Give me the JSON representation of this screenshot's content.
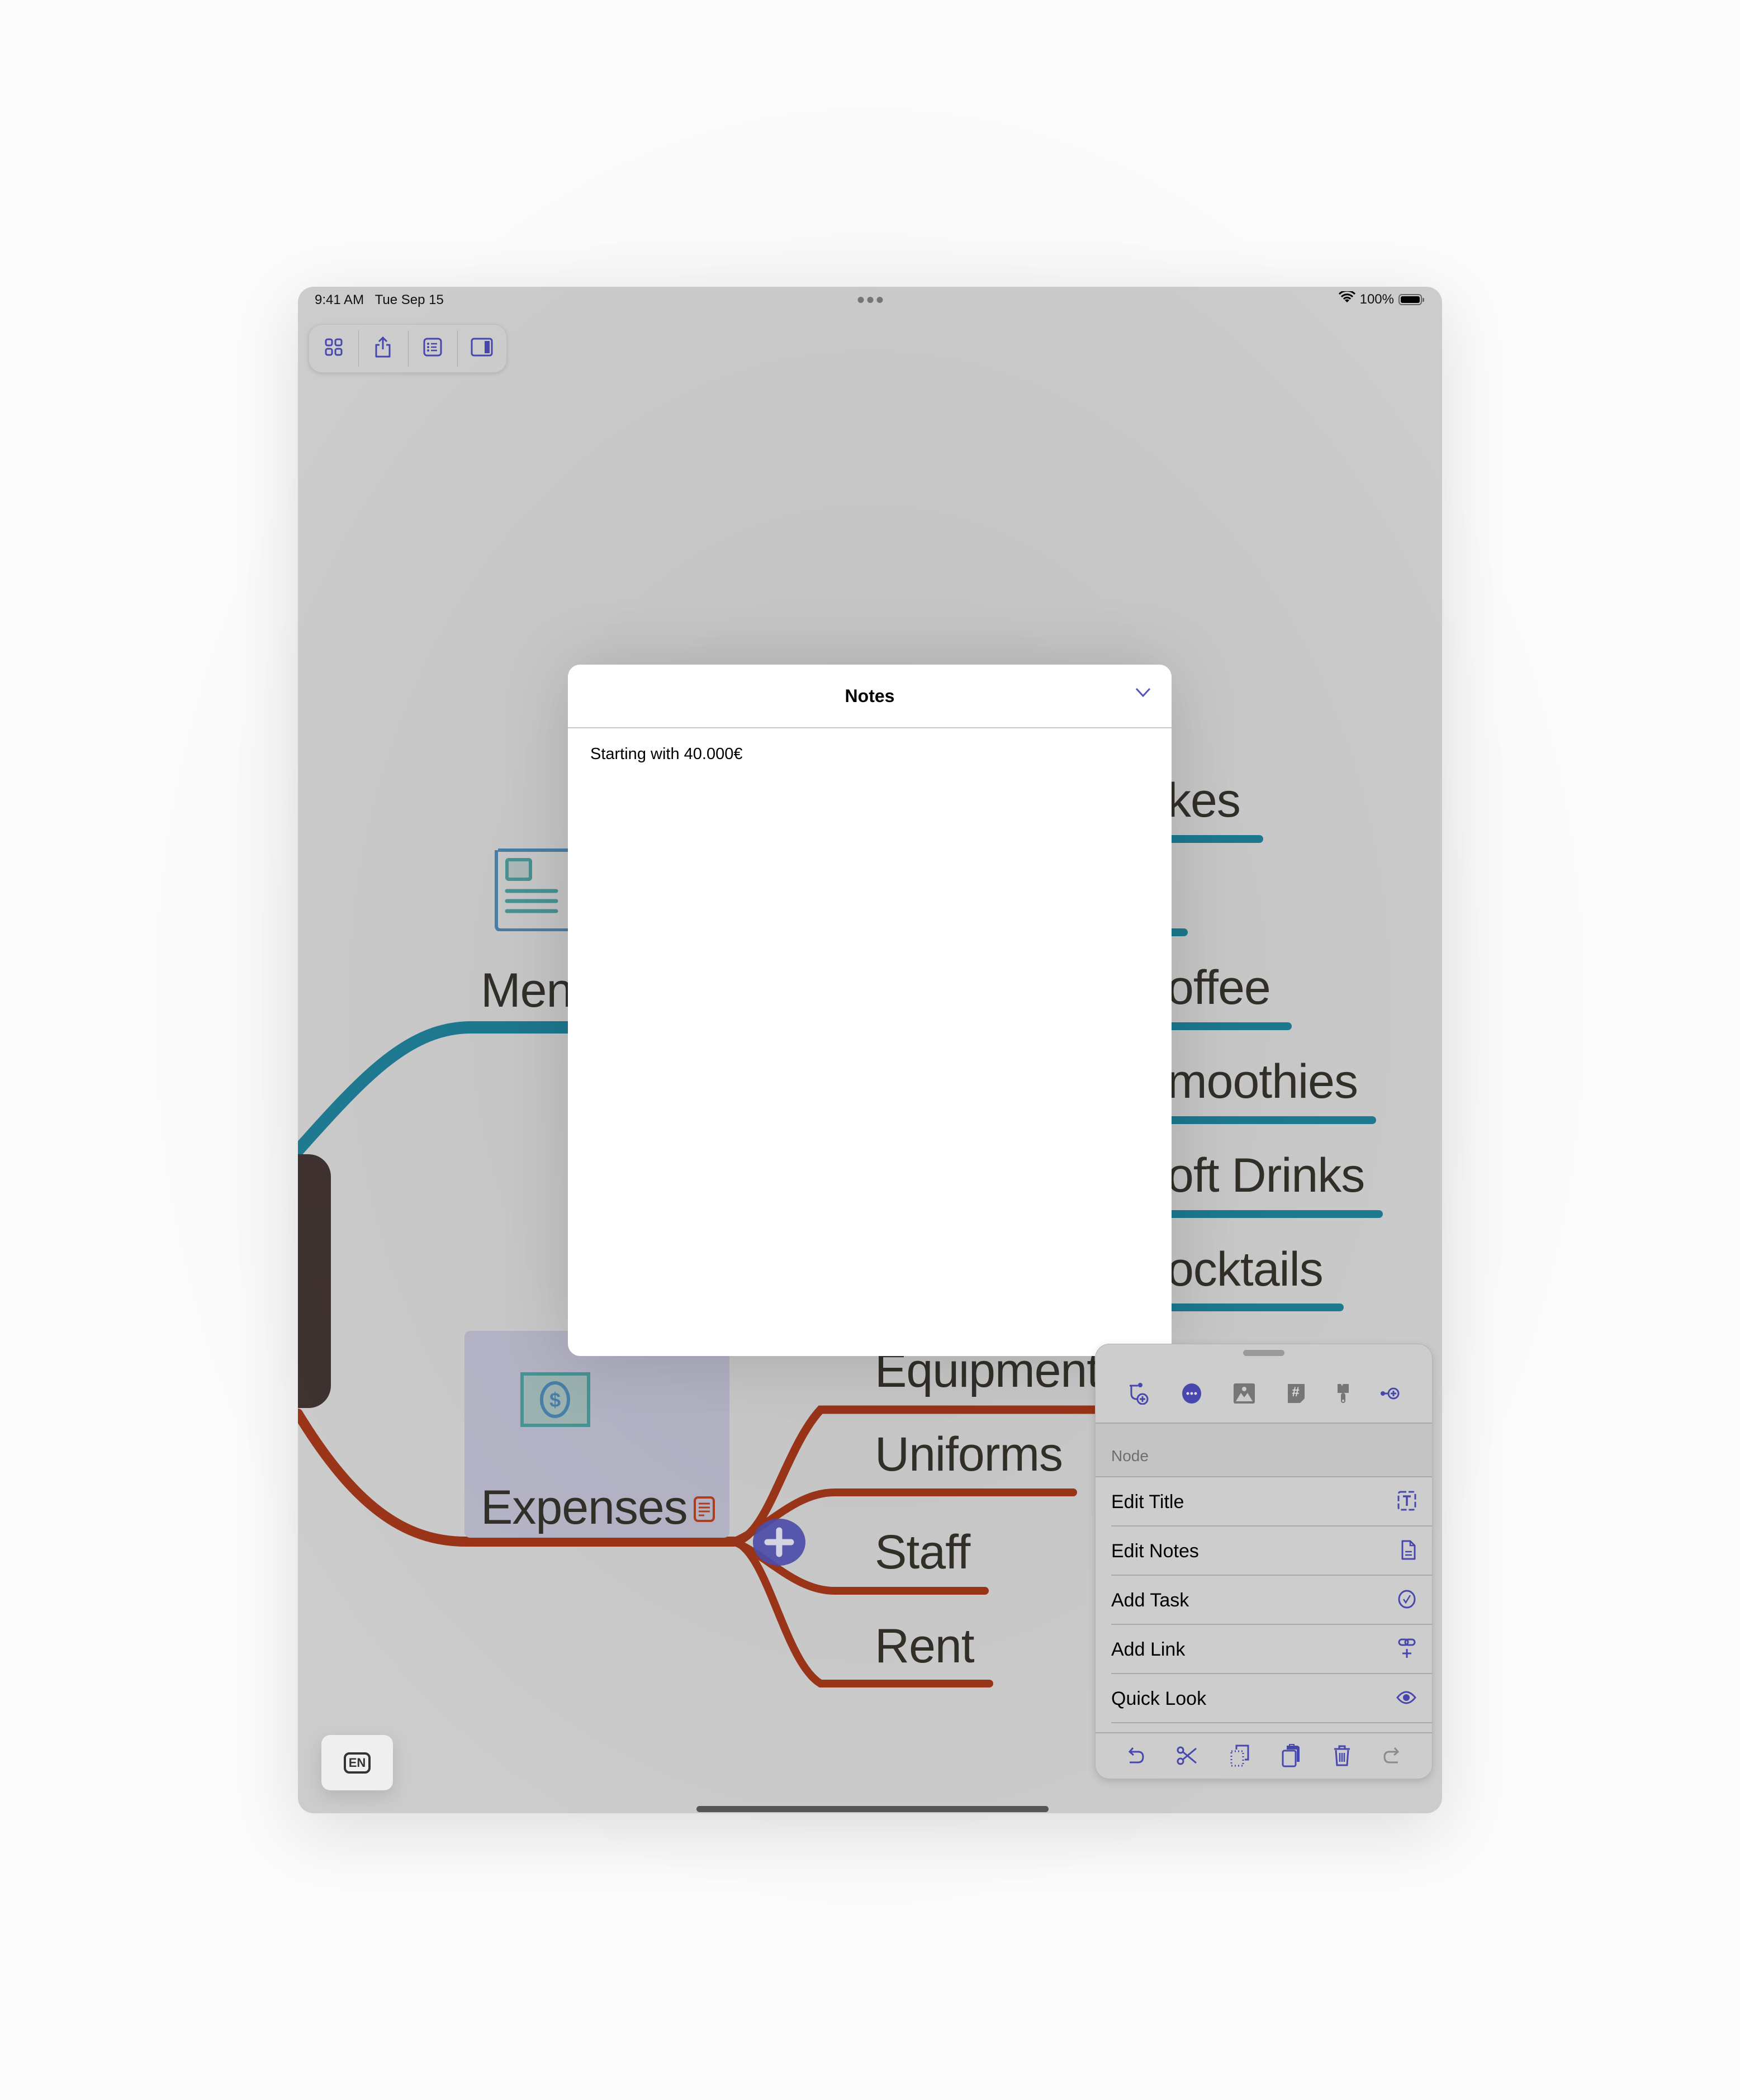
{
  "status_bar": {
    "time": "9:41 AM",
    "date": "Tue Sep 15",
    "battery": "100%",
    "wifi_icon": "wifi-icon",
    "battery_level": 1.0
  },
  "toolbar": {
    "buttons": [
      {
        "name": "grid-view",
        "icon": "grid-icon"
      },
      {
        "name": "share",
        "icon": "share-icon"
      },
      {
        "name": "outline",
        "icon": "list-icon"
      },
      {
        "name": "inspector",
        "icon": "sidebar-right-icon"
      }
    ]
  },
  "mindmap": {
    "colors": {
      "drinks_branch": "#1e7b93",
      "expenses_branch": "#9c3519",
      "central_node": "#3f3230",
      "accent": "#4a4aad"
    },
    "menu_node": {
      "label": "Men",
      "icon": "newspaper-icon"
    },
    "drinks_children": [
      "kes",
      "offee",
      "moothies",
      "oft Drinks",
      "ocktails"
    ],
    "expenses_node": {
      "label": "Expenses",
      "icon": "money-icon",
      "notes_icon": "notes-icon"
    },
    "expenses_children": [
      "Equipment",
      "Uniforms",
      "Staff",
      "Rent"
    ]
  },
  "notes_modal": {
    "title": "Notes",
    "content": "Starting with 40.000€",
    "collapse_icon": "chevron-down-icon"
  },
  "node_panel": {
    "top_icons": [
      "add-child-icon",
      "more-icon",
      "image-icon",
      "tag-icon",
      "style-brush-icon",
      "add-sibling-icon"
    ],
    "section_label": "Node",
    "items": [
      {
        "label": "Edit Title",
        "icon": "text-frame-icon"
      },
      {
        "label": "Edit Notes",
        "icon": "document-icon"
      },
      {
        "label": "Add Task",
        "icon": "checkmark-circle-icon"
      },
      {
        "label": "Add Link",
        "icon": "link-plus-icon"
      },
      {
        "label": "Quick Look",
        "icon": "eye-icon"
      }
    ],
    "bottom_icons": [
      "undo-icon",
      "cut-icon",
      "copy-icon",
      "paste-icon",
      "trash-icon",
      "redo-icon"
    ]
  },
  "keyboard_button": {
    "label": "EN"
  }
}
